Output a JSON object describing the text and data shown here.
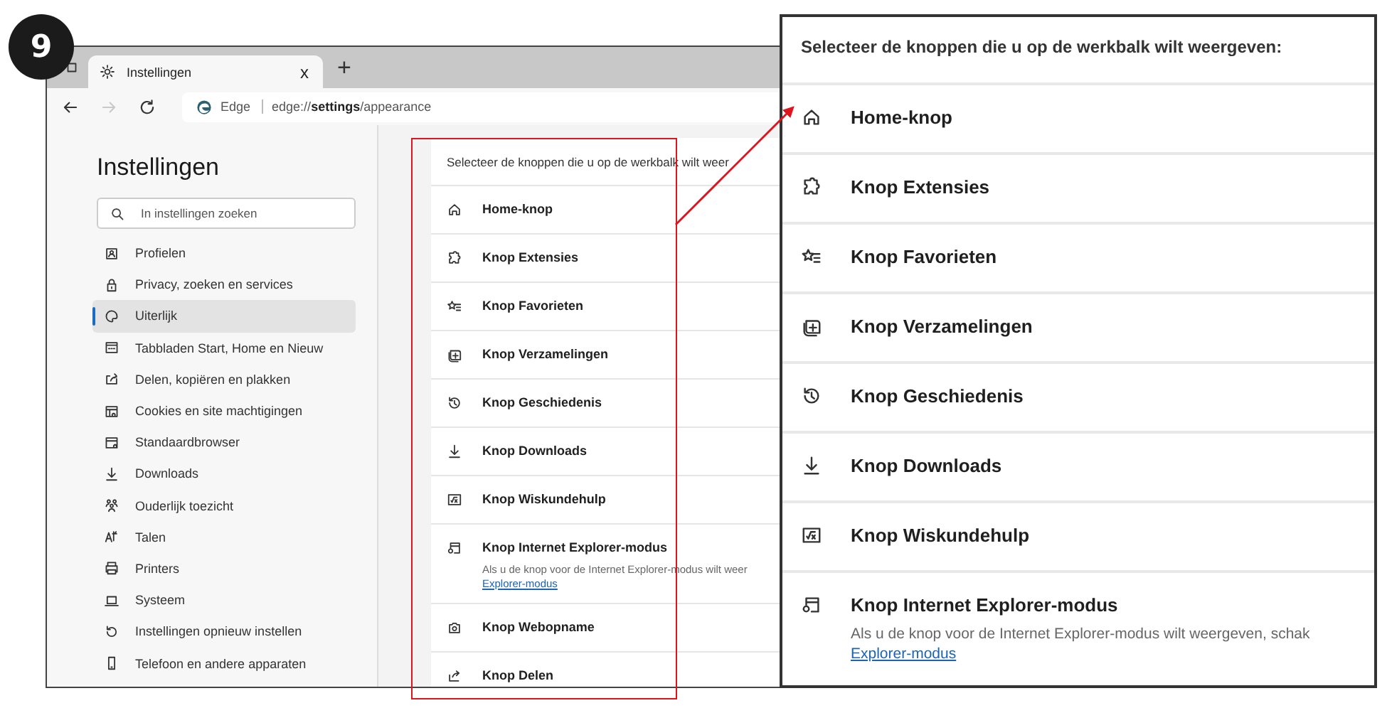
{
  "step_badge": "9",
  "browser": {
    "tab": {
      "title": "Instellingen",
      "close": "x",
      "selected": true
    },
    "new_tab": "+",
    "toolbar_buttons": [
      {
        "kind": "back",
        "disabled": false
      },
      {
        "kind": "forward",
        "disabled": true
      },
      {
        "kind": "refresh",
        "disabled": false
      }
    ],
    "address_bar": {
      "site": "Edge",
      "url": "edge://**settings**/appearance"
    }
  },
  "sidebar": {
    "title": "Instellingen",
    "search": {
      "placeholder": "In instellingen zoeken"
    },
    "items": [
      {
        "label": "Profielen",
        "selected": false
      },
      {
        "label": "Privacy, zoeken en services",
        "selected": false
      },
      {
        "label": "Uiterlijk",
        "selected": true
      },
      {
        "label": "Tabbladen Start, Home en Nieuw",
        "selected": false
      },
      {
        "label": "Delen, kopiëren en plakken",
        "selected": false
      },
      {
        "label": "Cookies en site machtigingen",
        "selected": false
      },
      {
        "label": "Standaardbrowser",
        "selected": false
      },
      {
        "label": "Downloads",
        "selected": false
      },
      {
        "label": "Ouderlijk toezicht",
        "selected": false
      },
      {
        "label": "Talen",
        "selected": false
      },
      {
        "label": "Printers",
        "selected": false
      },
      {
        "label": "Systeem",
        "selected": false
      },
      {
        "label": "Instellingen opnieuw instellen",
        "selected": false
      },
      {
        "label": "Telefoon en andere apparaten",
        "selected": false
      }
    ]
  },
  "main_card": {
    "heading": "Selecteer de knoppen die u op de werkbalk wilt weer",
    "rows": [
      {
        "label": "Home-knop"
      },
      {
        "label": "Knop Extensies"
      },
      {
        "label": "Knop Favorieten"
      },
      {
        "label": "Knop Verzamelingen"
      },
      {
        "label": "Knop Geschiedenis"
      },
      {
        "label": "Knop Downloads"
      },
      {
        "label": "Knop Wiskundehulp"
      },
      {
        "label": "Knop Internet Explorer-modus",
        "description": "Als u de knop voor de Internet Explorer-modus wilt weer",
        "link": "Explorer-modus"
      },
      {
        "label": "Knop Webopname"
      },
      {
        "label": "Knop Delen"
      }
    ]
  },
  "callout": {
    "heading": "Selecteer de knoppen die u op de werkbalk wilt weergeven:",
    "rows": [
      {
        "label": "Home-knop"
      },
      {
        "label": "Knop Extensies"
      },
      {
        "label": "Knop Favorieten"
      },
      {
        "label": "Knop Verzamelingen"
      },
      {
        "label": "Knop Geschiedenis"
      },
      {
        "label": "Knop Downloads"
      },
      {
        "label": "Knop Wiskundehulp"
      },
      {
        "label": "Knop Internet Explorer-modus",
        "description": "Als u de knop voor de Internet Explorer-modus wilt weergeven, schak",
        "link": "Explorer-modus"
      }
    ]
  }
}
